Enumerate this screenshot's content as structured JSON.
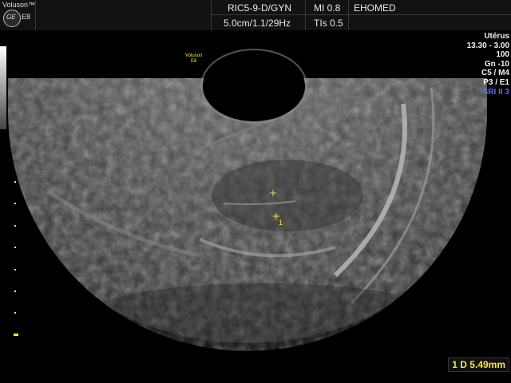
{
  "header": {
    "brand_suffix": "Voluson™",
    "model": "E8",
    "probe": "RIC5-9-D/GYN",
    "mi": "MI  0.8",
    "site": "EHOMED",
    "depth_info": "5.0cm/1.1/29Hz",
    "tis": "TIs  0.5"
  },
  "logo": {
    "ge_text": "GE"
  },
  "image_mark": {
    "line1": "Voluson",
    "line2": "E8"
  },
  "params": {
    "mode": "Utérus",
    "freq": "13.30 - 3.00",
    "power": "100",
    "gain": "Gn -10",
    "c_m": "C5 / M4",
    "p_e": "P3 / E1",
    "sri": "SRI II 3"
  },
  "measurement": {
    "text": "1  D 5.49mm"
  },
  "caliper_labels": {
    "number": "1"
  }
}
